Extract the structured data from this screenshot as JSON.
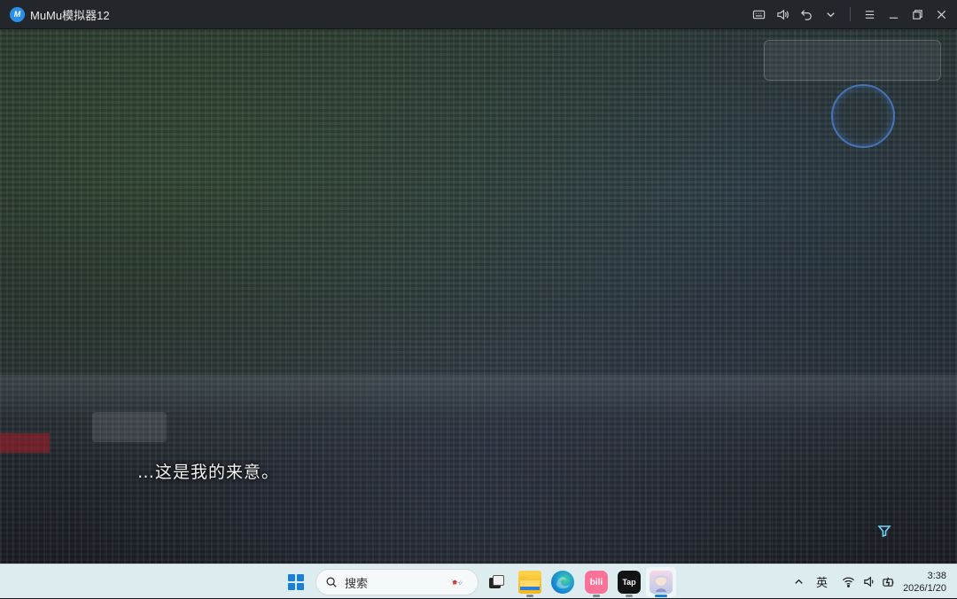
{
  "window": {
    "title": "MuMu模拟器12",
    "logo_text": "M"
  },
  "game": {
    "dialog_text": "…这是我的来意。"
  },
  "taskbar": {
    "search_placeholder": "搜索",
    "tap_label": "Tap",
    "bili_label": "bili",
    "ime_label": "英",
    "time": "3:38",
    "date": "2026/1/20"
  },
  "colors": {
    "titlebar_bg": "#23262b",
    "taskbar_bg": "#dcecef",
    "accent": "#1a7fd8"
  }
}
